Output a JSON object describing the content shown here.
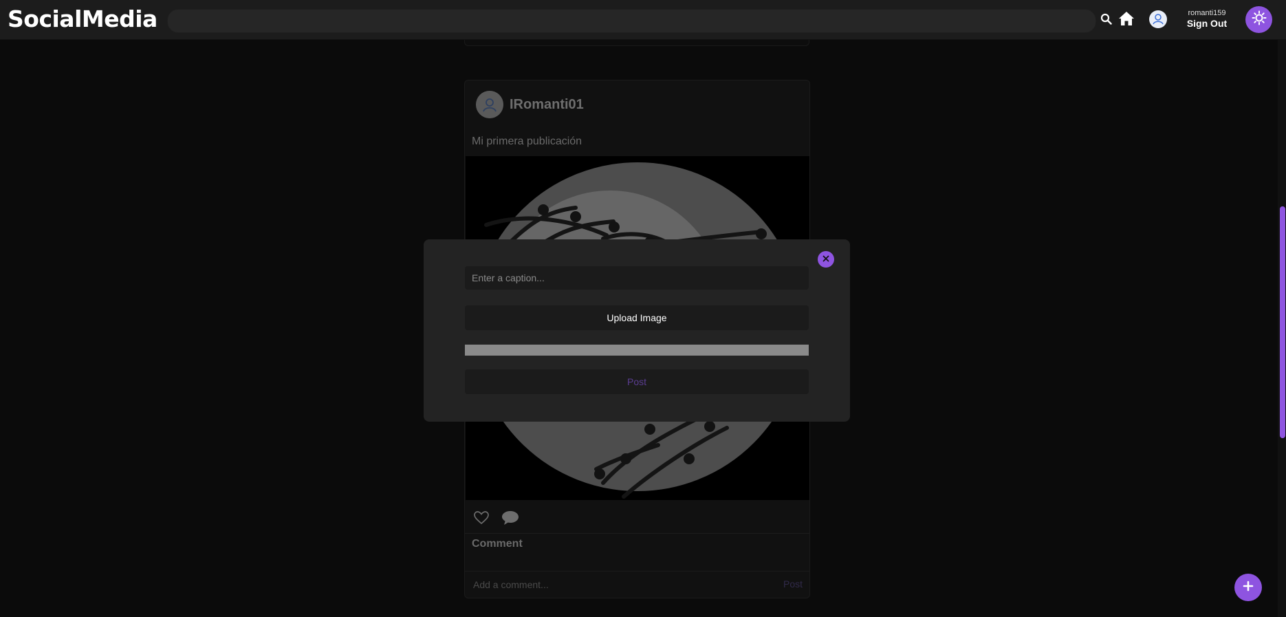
{
  "header": {
    "logo": "SocialMedia",
    "search_placeholder": "",
    "username": "romanti159",
    "sign_out_label": "Sign Out",
    "icons": [
      "search-icon",
      "home-icon",
      "user-avatar-icon",
      "sun-theme-icon"
    ]
  },
  "post": {
    "author": "IRomanti01",
    "caption": "Mi primera publicación",
    "comment_heading": "Comment",
    "comment_placeholder": "Add a comment...",
    "comment_post_label": "Post",
    "icons": [
      "heart-icon",
      "comment-bubble-icon"
    ]
  },
  "modal": {
    "caption_placeholder": "Enter a caption...",
    "upload_label": "Upload Image",
    "upload_progress": 1.0,
    "post_label": "Post",
    "close_icon": "close-icon"
  },
  "fab": {
    "icon": "plus-icon"
  },
  "colors": {
    "accent": "#8e54e0",
    "background": "#0b0b0b",
    "header": "#1c1c1c",
    "modal": "#232323"
  }
}
